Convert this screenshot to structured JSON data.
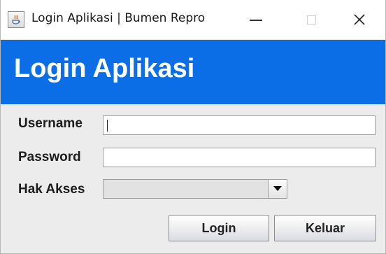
{
  "window": {
    "title": "Login Aplikasi | Bumen Repro",
    "minimize_icon": "minimize-icon",
    "maximize_icon": "maximize-icon",
    "close_icon": "close-icon",
    "close_glyph": "✕"
  },
  "banner": {
    "title": "Login Aplikasi",
    "color": "#0b6ee6"
  },
  "form": {
    "username_label": "Username",
    "username_value": "",
    "password_label": "Password",
    "password_value": "",
    "akses_label": "Hak Akses",
    "akses_value": "",
    "dropdown_icon": "chevron-down-icon"
  },
  "buttons": {
    "login_label": "Login",
    "keluar_label": "Keluar"
  }
}
